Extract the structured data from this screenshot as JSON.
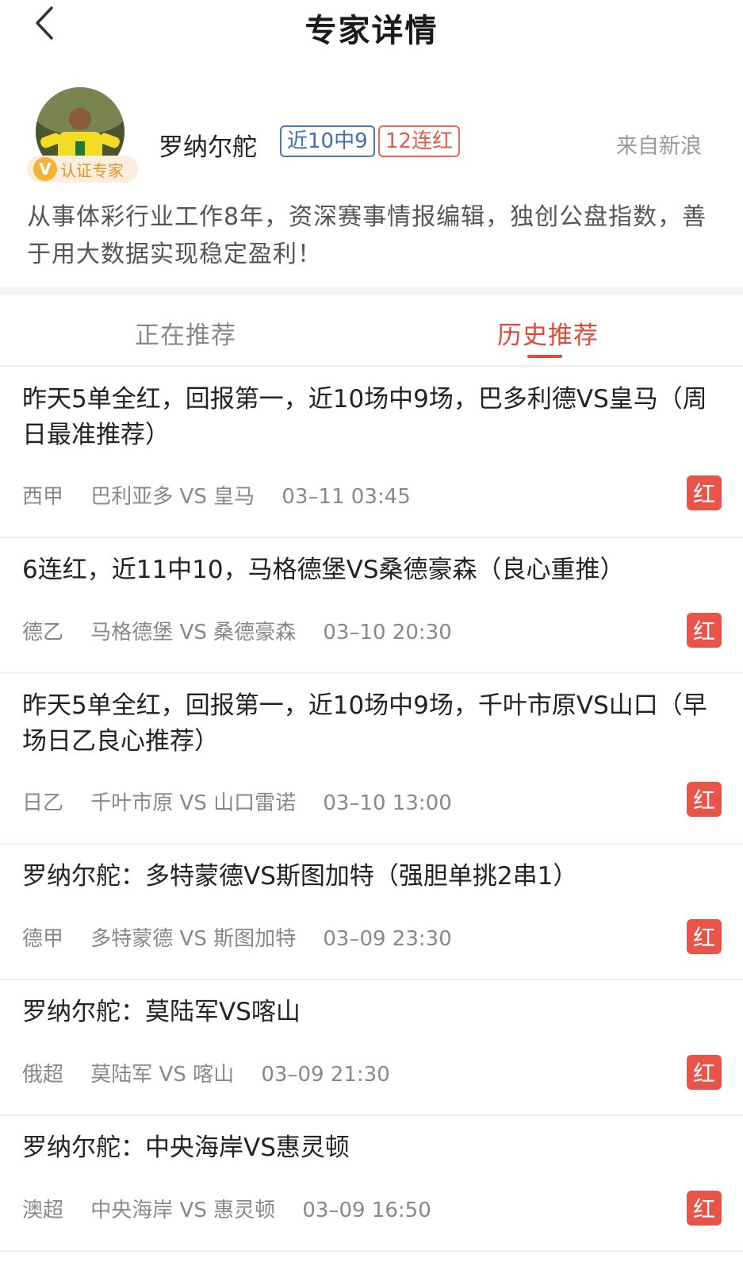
{
  "nav": {
    "title": "专家详情"
  },
  "expert": {
    "name": "罗纳尔舵",
    "cert_label": "认证专家",
    "tag_recent": "近10中9",
    "tag_streak": "12连红",
    "source": "来自新浪",
    "bio": "从事体彩行业工作8年，资深赛事情报编辑，独创公盘指数，善于用大数据实现稳定盈利！"
  },
  "tabs": {
    "current": "正在推荐",
    "history": "历史推荐",
    "active": "history"
  },
  "items": [
    {
      "title": "昨天5单全红，回报第一，近10场中9场，巴多利德VS皇马（周日最准推荐）",
      "league": "西甲",
      "match": "巴利亚多 VS 皇马",
      "time": "03–11 03:45",
      "result": "红"
    },
    {
      "title": "6连红，近11中10，马格德堡VS桑德豪森（良心重推）",
      "league": "德乙",
      "match": "马格德堡 VS 桑德豪森",
      "time": "03–10 20:30",
      "result": "红"
    },
    {
      "title": "昨天5单全红，回报第一，近10场中9场，千叶市原VS山口（早场日乙良心推荐）",
      "league": "日乙",
      "match": "千叶市原 VS 山口雷诺",
      "time": "03–10 13:00",
      "result": "红"
    },
    {
      "title": "罗纳尔舵：多特蒙德VS斯图加特（强胆单挑2串1）",
      "league": "德甲",
      "match": "多特蒙德 VS 斯图加特",
      "time": "03–09 23:30",
      "result": "红"
    },
    {
      "title": "罗纳尔舵：莫陆军VS喀山",
      "league": "俄超",
      "match": "莫陆军 VS 喀山",
      "time": "03–09 21:30",
      "result": "红"
    },
    {
      "title": "罗纳尔舵：中央海岸VS惠灵顿",
      "league": "澳超",
      "match": "中央海岸 VS 惠灵顿",
      "time": "03–09 16:50",
      "result": "红"
    }
  ]
}
